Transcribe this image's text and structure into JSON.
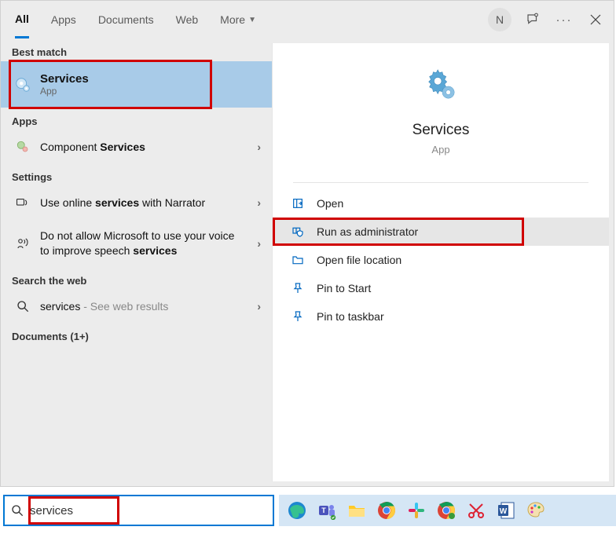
{
  "tabs": {
    "all": "All",
    "apps": "Apps",
    "documents": "Documents",
    "web": "Web",
    "more": "More"
  },
  "topbar": {
    "avatar": "N"
  },
  "sections": {
    "best_match": "Best match",
    "apps": "Apps",
    "settings": "Settings",
    "search_web": "Search the web",
    "documents": "Documents (1+)"
  },
  "best_match_item": {
    "title": "Services",
    "subtitle": "App"
  },
  "apps_items": [
    {
      "prefix": "Component ",
      "bold": "Services",
      "suffix": ""
    }
  ],
  "settings_items": [
    {
      "prefix": "Use online ",
      "bold": "services",
      "suffix": " with Narrator"
    },
    {
      "prefix": "Do not allow Microsoft to use your voice to improve speech ",
      "bold": "services",
      "suffix": ""
    }
  ],
  "web_items": [
    {
      "term": "services",
      "tail": " - See web results"
    }
  ],
  "preview": {
    "title": "Services",
    "subtitle": "App"
  },
  "actions": [
    {
      "label": "Open",
      "icon": "open",
      "selected": false
    },
    {
      "label": "Run as administrator",
      "icon": "admin",
      "selected": true
    },
    {
      "label": "Open file location",
      "icon": "folder",
      "selected": false
    },
    {
      "label": "Pin to Start",
      "icon": "pin",
      "selected": false
    },
    {
      "label": "Pin to taskbar",
      "icon": "pin",
      "selected": false
    }
  ],
  "search": {
    "value": "services"
  },
  "taskbar_icons": [
    "edge",
    "teams",
    "explorer",
    "chrome",
    "slack",
    "chrome2",
    "snip",
    "word",
    "paint"
  ]
}
